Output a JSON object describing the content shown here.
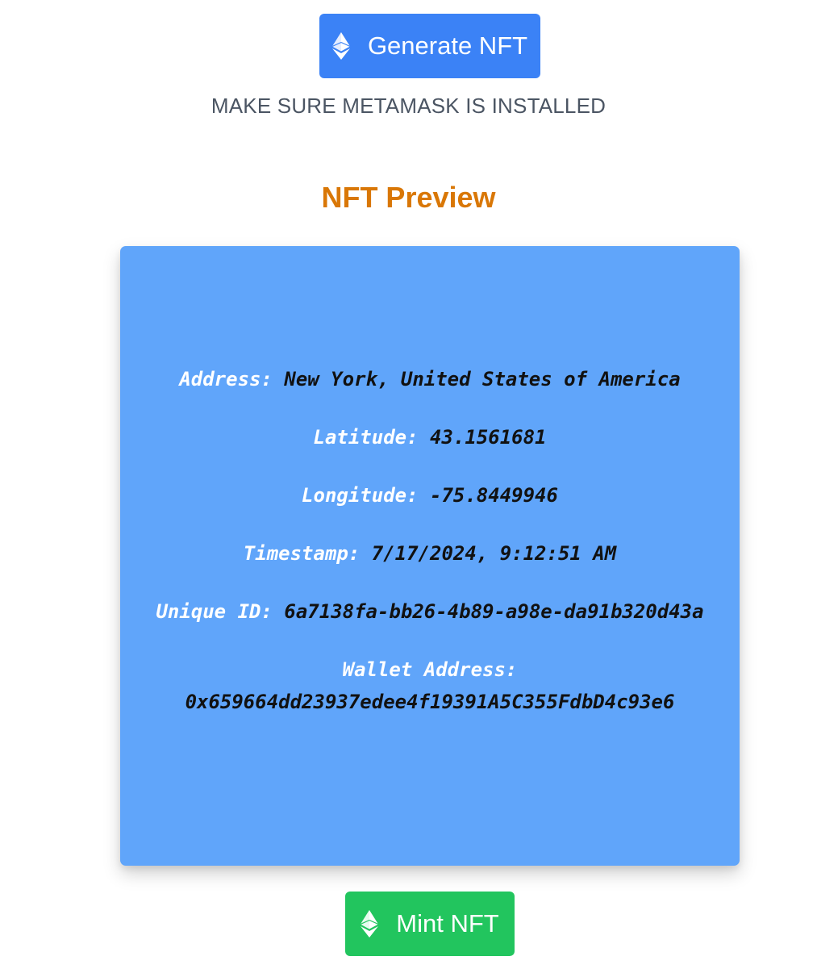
{
  "header": {
    "generate_label": "Generate NFT",
    "notice": "MAKE SURE METAMASK IS INSTALLED"
  },
  "preview": {
    "title": "NFT Preview",
    "fields": {
      "address": {
        "label": "Address:",
        "value": "New York, United States of America"
      },
      "latitude": {
        "label": "Latitude:",
        "value": "43.1561681"
      },
      "longitude": {
        "label": "Longitude:",
        "value": "-75.8449946"
      },
      "timestamp": {
        "label": "Timestamp:",
        "value": "7/17/2024, 9:12:51 AM"
      },
      "unique_id": {
        "label": "Unique ID:",
        "value": "6a7138fa-bb26-4b89-a98e-da91b320d43a"
      },
      "wallet": {
        "label": "Wallet Address:",
        "value": "0x659664dd23937edee4f19391A5C355FdbD4c93e6"
      }
    }
  },
  "footer": {
    "mint_label": "Mint NFT"
  },
  "icons": {
    "button_icon": "ethereum-icon"
  },
  "colors": {
    "generate_button": "#3b82f6",
    "mint_button": "#22c55e",
    "preview_title": "#d97706",
    "card_background": "#60a5fa",
    "notice_text": "#4b5563"
  }
}
